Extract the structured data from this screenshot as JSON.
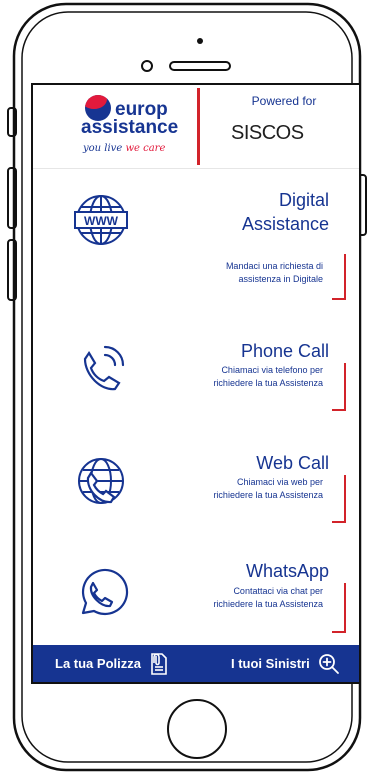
{
  "header": {
    "brand_line1": "europ",
    "brand_line2": "assistance",
    "tagline_prefix": "you live",
    "tagline_suffix": "we care",
    "powered_label": "Powered for",
    "partner_name": "SISCOS"
  },
  "services": [
    {
      "title_line1": "Digital",
      "title_line2": "Assistance",
      "desc_line1": "Mandaci una richiesta di",
      "desc_line2": "assistenza in Digitale",
      "icon": "globe-www-icon"
    },
    {
      "title_line1": "Phone Call",
      "title_line2": "",
      "desc_line1": "Chiamaci via telefono per",
      "desc_line2": "richiedere la tua Assistenza",
      "icon": "phone-ringing-icon"
    },
    {
      "title_line1": "Web Call",
      "title_line2": "",
      "desc_line1": "Chiamaci via web per",
      "desc_line2": "richiedere la tua Assistenza",
      "icon": "globe-phone-icon"
    },
    {
      "title_line1": "WhatsApp",
      "title_line2": "",
      "desc_line1": "Contattaci via chat per",
      "desc_line2": "richiedere la tua Assistenza",
      "icon": "whatsapp-icon"
    }
  ],
  "bottom_bar": {
    "policy_label": "La tua Polizza",
    "claims_label": "I tuoi Sinistri"
  },
  "colors": {
    "brand_blue": "#163491",
    "accent_red": "#d2232a"
  }
}
